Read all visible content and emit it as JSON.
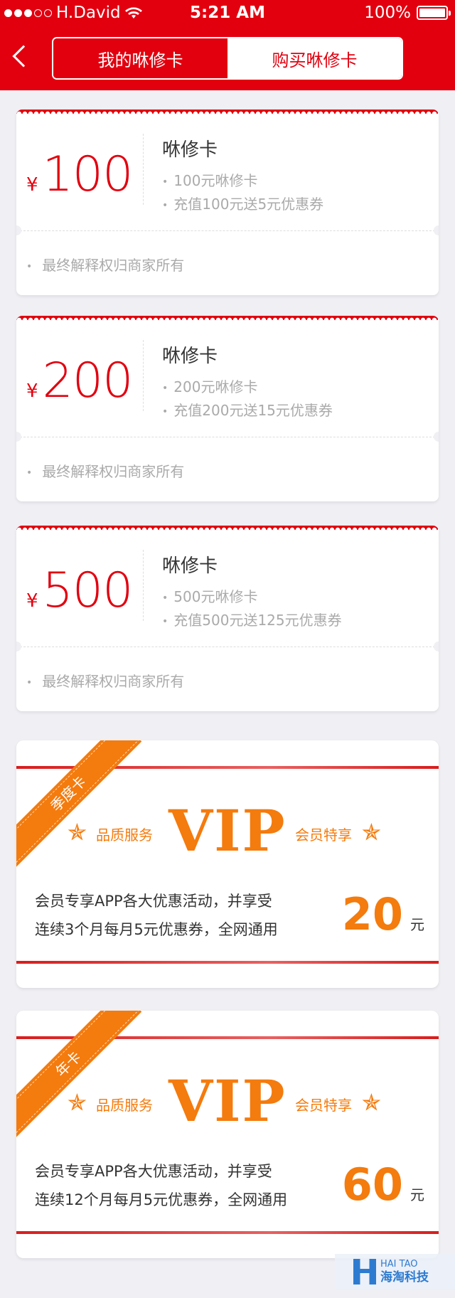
{
  "status_bar": {
    "carrier": "H.David",
    "time": "5:21 AM",
    "battery": "100%"
  },
  "nav": {
    "tabs": [
      {
        "label": "我的咻修卡",
        "active": true
      },
      {
        "label": "购买咻修卡",
        "active": false
      }
    ]
  },
  "cards": [
    {
      "currency": "¥",
      "amount": "100",
      "title": "咻修卡",
      "line1": "100元咻修卡",
      "line2": "充值100元送5元优惠券",
      "footer": "最终解释权归商家所有"
    },
    {
      "currency": "¥",
      "amount": "200",
      "title": "咻修卡",
      "line1": "200元咻修卡",
      "line2": "充值200元送15元优惠券",
      "footer": "最终解释权归商家所有"
    },
    {
      "currency": "¥",
      "amount": "500",
      "title": "咻修卡",
      "line1": "500元咻修卡",
      "line2": "充值500元送125元优惠券",
      "footer": "最终解释权归商家所有"
    }
  ],
  "vip_cards": [
    {
      "ribbon": "季度卡",
      "left_label": "品质服务",
      "vip": "VIP",
      "right_label": "会员特享",
      "desc1": "会员专享APP各大优惠活动，并享受",
      "desc2": "连续3个月每月5元优惠券，全网通用",
      "price": "20",
      "unit": "元"
    },
    {
      "ribbon": "年卡",
      "left_label": "品质服务",
      "vip": "VIP",
      "right_label": "会员特享",
      "desc1": "会员专享APP各大优惠活动，并享受",
      "desc2": "连续12个月每月5元优惠券，全网通用",
      "price": "60",
      "unit": "元"
    }
  ],
  "watermark": {
    "latin": "HAI TAO",
    "chinese": "海淘科技"
  },
  "colors": {
    "brand_red": "#e2000f",
    "vip_orange": "#f47b0d",
    "background": "#efeff4"
  }
}
